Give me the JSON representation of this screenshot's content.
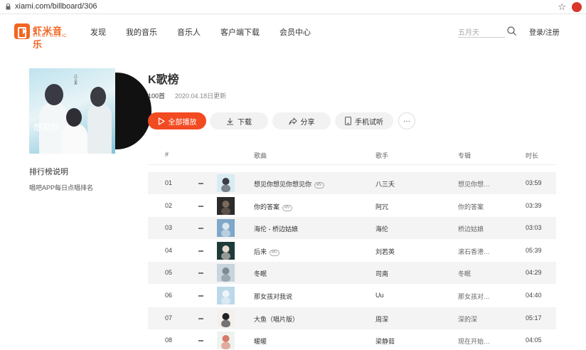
{
  "browser": {
    "url": "xiami.com/billboard/306"
  },
  "header": {
    "logo_text": "虾米音乐",
    "logo_sub": "XIAMI MUSIC",
    "nav": [
      "发现",
      "我的音乐",
      "音乐人",
      "客户端下载",
      "会员中心"
    ],
    "search_placeholder": "五月天",
    "login": "登录/注册"
  },
  "board": {
    "cover_title": "想见你",
    "cover_side": "八三夭",
    "desc_title": "排行榜说明",
    "desc_text": "唱吧APP每日点唱排名",
    "title": "K歌榜",
    "count": "100首",
    "date": "2020.04.18日更新"
  },
  "actions": {
    "play": "全部播放",
    "download": "下载",
    "share": "分享",
    "phone": "手机试听",
    "more": "···"
  },
  "columns": {
    "num": "#",
    "song": "歌曲",
    "artist": "歌手",
    "album": "专辑",
    "duration": "时长"
  },
  "colors": {
    "accent": "#f24b22"
  },
  "tracks": [
    {
      "num": "01",
      "song": "想见你想见你想见你",
      "mv": "MV",
      "artist": "八三夭",
      "album": "想见你想…",
      "duration": "03:59"
    },
    {
      "num": "02",
      "song": "你的答案",
      "mv": "MV",
      "artist": "阿冗",
      "album": "你的答案",
      "duration": "03:39"
    },
    {
      "num": "03",
      "song": "海伦 - 桥边姑娘",
      "mv": "",
      "artist": "海伦",
      "album": "桥边姑娘",
      "duration": "03:03"
    },
    {
      "num": "04",
      "song": "后来",
      "mv": "MV",
      "artist": "刘若英",
      "album": "滚石香港…",
      "duration": "05:39"
    },
    {
      "num": "05",
      "song": "冬眠",
      "mv": "",
      "artist": "司南",
      "album": "冬眠",
      "duration": "04:29"
    },
    {
      "num": "06",
      "song": "那女孩对我说",
      "mv": "",
      "artist": "Uu",
      "album": "那女孩对…",
      "duration": "04:40"
    },
    {
      "num": "07",
      "song": "大鱼（唱片版）",
      "mv": "",
      "artist": "周深",
      "album": "深的深",
      "duration": "05:17"
    },
    {
      "num": "08",
      "song": "暖暖",
      "mv": "",
      "artist": "梁静茹",
      "album": "现在开始…",
      "duration": "04:05"
    }
  ]
}
